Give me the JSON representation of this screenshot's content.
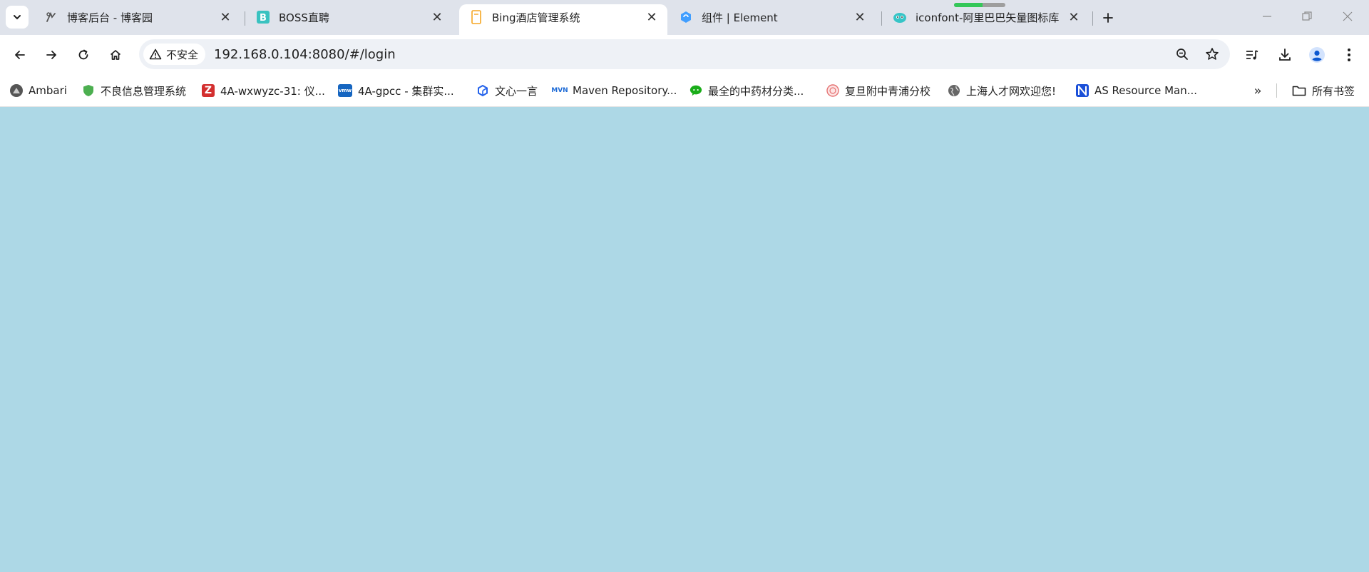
{
  "tabs": [
    {
      "title": "博客后台 - 博客园",
      "close": "✕"
    },
    {
      "title": "BOSS直聘",
      "close": "✕"
    },
    {
      "title": "Bing酒店管理系统",
      "close": "✕"
    },
    {
      "title": "组件 | Element",
      "close": "✕"
    },
    {
      "title": "iconfont-阿里巴巴矢量图标库",
      "close": "✕"
    }
  ],
  "new_tab_label": "+",
  "address_bar": {
    "security_label": "不安全",
    "url": "192.168.0.104:8080/#/login"
  },
  "bookmarks": [
    {
      "label": "Ambari",
      "icon_color": "#555555"
    },
    {
      "label": "不良信息管理系统",
      "icon_color": "#4caf50"
    },
    {
      "label": "4A-wxwyzc-31: 仪...",
      "icon_color": "#e53935",
      "icon_text": "Z"
    },
    {
      "label": "4A-gpcc - 集群实...",
      "icon_color": "#1565c0",
      "icon_text": "vmw"
    },
    {
      "label": "文心一言",
      "icon_color": "#2563eb"
    },
    {
      "label": "Maven Repository...",
      "icon_color": "#1e6bd6",
      "icon_text": "MVN"
    },
    {
      "label": "最全的中药材分类...",
      "icon_color": "#1aad19"
    },
    {
      "label": "复旦附中青浦分校",
      "icon_color": "#e57373"
    },
    {
      "label": "上海人才网欢迎您!",
      "icon_color": "#666666"
    },
    {
      "label": "AS Resource Man...",
      "icon_color": "#1a4fd8",
      "icon_text": "N"
    }
  ],
  "bookmarks_more": "»",
  "all_bookmarks_label": "所有书签",
  "page_load_progress": 0.55,
  "page_background": "#add8e6"
}
